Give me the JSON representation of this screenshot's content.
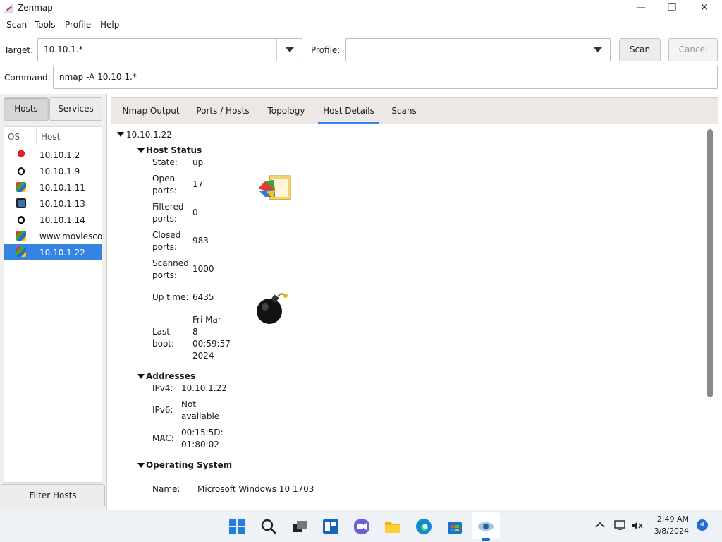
{
  "window": {
    "title": "Zenmap",
    "minimize": "—",
    "maximize": "❐",
    "close": "✕"
  },
  "menu": [
    "Scan",
    "Tools",
    "Profile",
    "Help"
  ],
  "target": {
    "label": "Target:",
    "value": "10.10.1.*"
  },
  "profile": {
    "label": "Profile:",
    "value": ""
  },
  "buttons": {
    "scan": "Scan",
    "cancel": "Cancel",
    "filter": "Filter Hosts"
  },
  "command": {
    "label": "Command:",
    "value": "nmap -A 10.10.1.*"
  },
  "left": {
    "hosts_tab": "Hosts",
    "services_tab": "Services",
    "col_os": "OS",
    "col_host": "Host",
    "hosts": [
      {
        "name": "10.10.1.2",
        "os_icon": "freebsd-icon"
      },
      {
        "name": "10.10.1.9",
        "os_icon": "linux-icon"
      },
      {
        "name": "10.10.1.11",
        "os_icon": "windows-icon"
      },
      {
        "name": "10.10.1.13",
        "os_icon": "mac-icon"
      },
      {
        "name": "10.10.1.14",
        "os_icon": "linux-icon"
      },
      {
        "name": "www.moviescope",
        "os_icon": "windows-icon"
      },
      {
        "name": "10.10.1.22",
        "os_icon": "windows-icon",
        "selected": true
      }
    ]
  },
  "tabs": [
    "Nmap Output",
    "Ports / Hosts",
    "Topology",
    "Host Details",
    "Scans"
  ],
  "active_tab": "Host Details",
  "details": {
    "host": "10.10.1.22",
    "host_status": {
      "heading": "Host Status",
      "state_label": "State:",
      "state": "up",
      "open_label_1": "Open",
      "open_label_2": "ports:",
      "open": "17",
      "filtered_label_1": "Filtered",
      "filtered_label_2": "ports:",
      "filtered": "0",
      "closed_label_1": "Closed",
      "closed_label_2": "ports:",
      "closed": "983",
      "scanned_label_1": "Scanned",
      "scanned_label_2": "ports:",
      "scanned": "1000",
      "uptime_label": "Up time:",
      "uptime": "6435",
      "lastboot_label_1": "Last",
      "lastboot_label_2": "boot:",
      "lastboot_1": "Fri Mar",
      "lastboot_2": "8",
      "lastboot_3": "00:59:57",
      "lastboot_4": "2024"
    },
    "addresses": {
      "heading": "Addresses",
      "ipv4_label": "IPv4:",
      "ipv4": "10.10.1.22",
      "ipv6_label": "IPv6:",
      "ipv6_1": "Not",
      "ipv6_2": "available",
      "mac_label": "MAC:",
      "mac_1": "00:15:5D:",
      "mac_2": "01:80:02"
    },
    "os": {
      "heading": "Operating System",
      "name_label": "Name:",
      "name": "Microsoft Windows 10 1703"
    }
  },
  "taskbar": {
    "icons": [
      "windows-start-icon",
      "search-icon",
      "task-view-icon",
      "widgets-icon",
      "chat-icon",
      "file-explorer-icon",
      "edge-icon",
      "store-icon",
      "zenmap-icon"
    ],
    "time": "2:49 AM",
    "date": "3/8/2024",
    "notifications": "4"
  }
}
